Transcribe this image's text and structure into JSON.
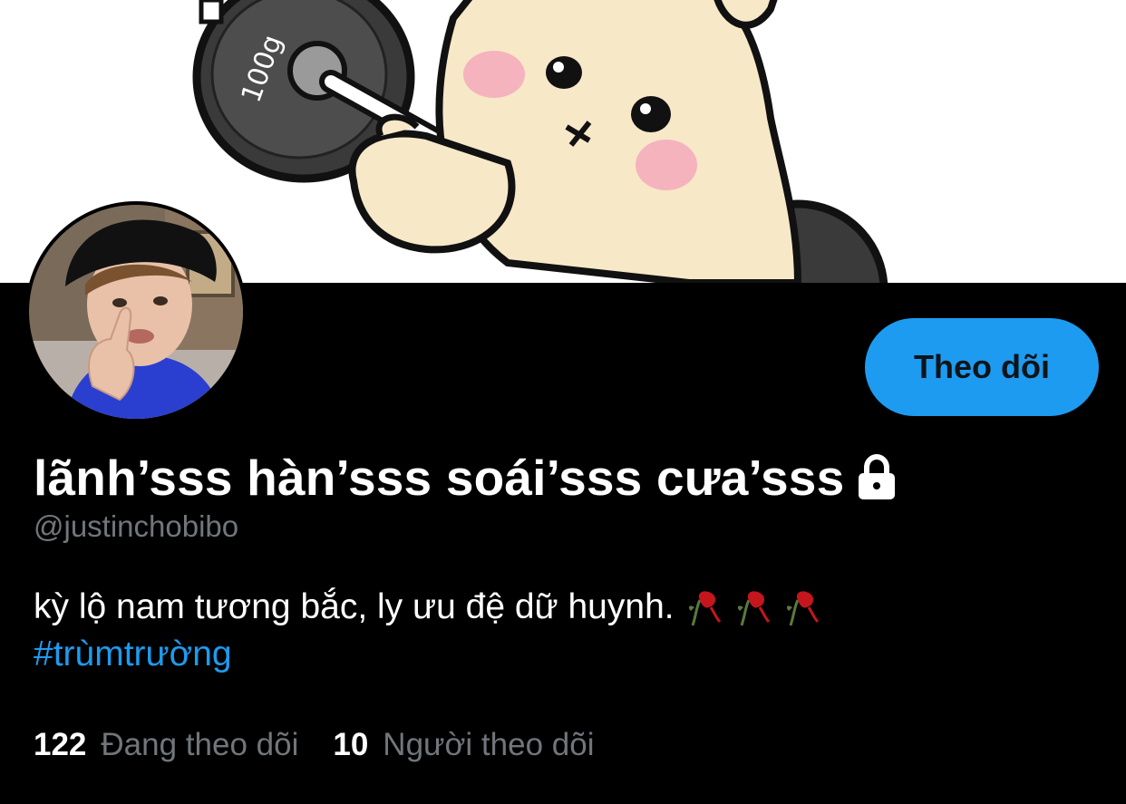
{
  "banner": {
    "image": "cartoon-bunny-lifting-barbell",
    "weight_text": "100g"
  },
  "avatar": {
    "image": "profile-photo"
  },
  "follow_button": {
    "label": "Theo dõi",
    "color": "#1d9bf0"
  },
  "profile": {
    "display_name": "lãnh’sss hàn’sss soái’sss cưa’sss",
    "locked_icon": "lock-icon",
    "handle": "@justinchobibo",
    "bio_text": "kỳ lộ nam tương bắc, ly ưu đệ dữ huynh.",
    "bio_emoji": [
      "wilted-rose-icon",
      "wilted-rose-icon",
      "wilted-rose-icon"
    ],
    "hashtag": "#trùmtrường"
  },
  "stats": {
    "following_count": "122",
    "following_label": "Đang theo dõi",
    "followers_count": "10",
    "followers_label": "Người theo dõi"
  },
  "colors": {
    "background": "#000000",
    "accent": "#1d9bf0",
    "muted": "#71767b",
    "text": "#ffffff"
  }
}
